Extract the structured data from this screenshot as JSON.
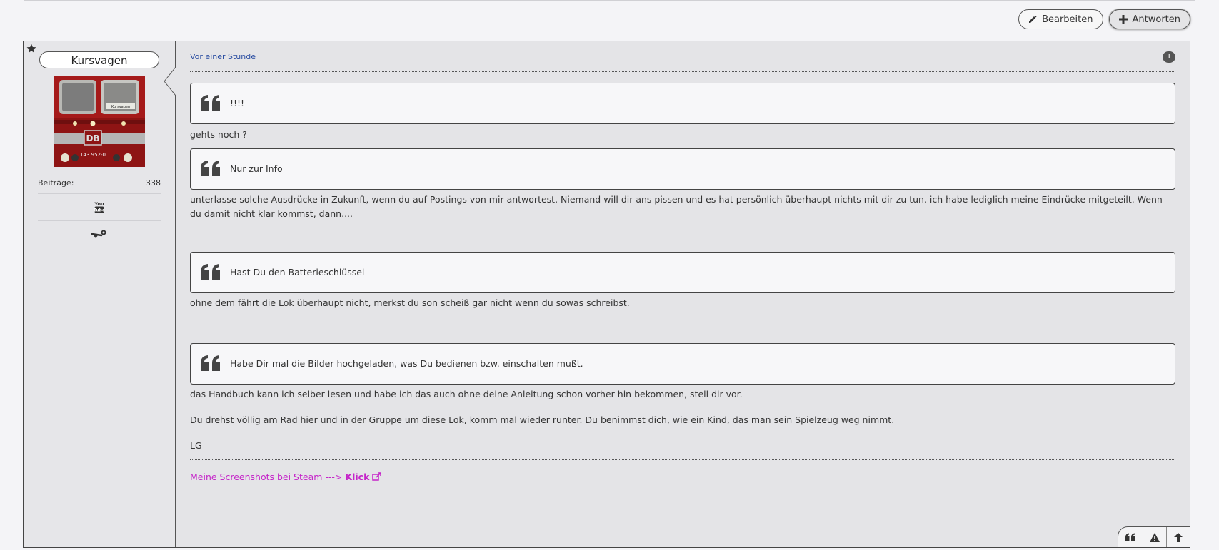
{
  "toolbar": {
    "edit_label": "Bearbeiten",
    "reply_label": "Antworten"
  },
  "author": {
    "name": "Kursvagen",
    "stat_label": "Beiträge:",
    "stat_value": "338",
    "avatar_text": "DB",
    "avatar_number": "143 952-0",
    "avatar_sign": "Kursvagen"
  },
  "post": {
    "date": "Vor einer Stunde",
    "number": "1",
    "quotes": [
      "!!!!",
      "Nur zur Info",
      "Hast Du den Batterieschlüssel",
      "Habe Dir mal die Bilder hochgeladen, was Du bedienen bzw. einschalten mußt."
    ],
    "paragraphs": [
      "gehts noch ?",
      "unterlasse solche Ausdrücke in Zukunft, wenn du auf Postings von mir antwortest. Niemand will dir ans pissen und es hat persönlich überhaupt nichts mit dir zu tun, ich habe lediglich meine Eindrücke mitgeteilt. Wenn du damit nicht klar kommst, dann....",
      "ohne dem fährt die Lok überhaupt nicht, merkst du son scheiß gar nicht wenn du sowas schreibst.",
      "das Handbuch kann ich selber lesen und habe ich das auch ohne deine Anleitung schon vorher hin bekommen, stell dir vor.",
      "Du drehst völlig am Rad hier und in der Gruppe um diese Lok, komm mal wieder runter. Du benimmst dich, wie ein Kind, das man sein Spielzeug weg nimmt.",
      "LG"
    ],
    "signature_text": "Meine Screenshots bei Steam --->",
    "signature_link": "Klick"
  },
  "colors": {
    "signature": "#c524c9",
    "date_link": "#2b4ea2"
  },
  "icons": [
    "pencil-icon",
    "plus-icon",
    "star-icon",
    "youtube-icon",
    "steam-icon",
    "quote-icon",
    "external-link-icon",
    "warning-icon",
    "arrow-up-icon"
  ]
}
